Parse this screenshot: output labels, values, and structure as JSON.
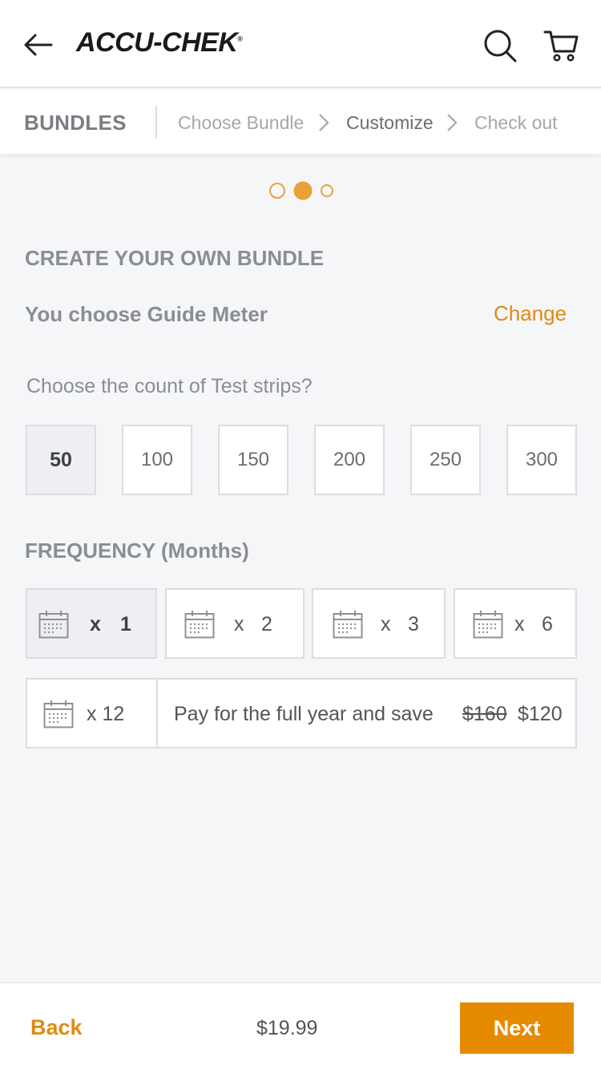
{
  "header": {
    "logo_text": "ACCU-CHEK",
    "logo_mark": "®",
    "icons": [
      "back-arrow-icon",
      "search-icon",
      "cart-icon"
    ]
  },
  "steps": {
    "title": "BUNDLES",
    "items": [
      {
        "label": "Choose Bundle",
        "state": "done"
      },
      {
        "label": "Customize",
        "state": "active"
      },
      {
        "label": "Check out",
        "state": "pending"
      }
    ]
  },
  "pager": {
    "total": 3,
    "active_index": 1
  },
  "bundle": {
    "title": "CREATE YOUR OWN BUNDLE",
    "meter_text": "You choose Guide Meter",
    "change_label": "Change"
  },
  "strips": {
    "question": "Choose the count of Test strips?",
    "options": [
      "50",
      "100",
      "150",
      "200",
      "250",
      "300"
    ],
    "selected": "50"
  },
  "frequency": {
    "title": "FREQUENCY (Months)",
    "options": [
      {
        "prefix": "x",
        "value": "1",
        "selected": true
      },
      {
        "prefix": "x",
        "value": "2",
        "selected": false
      },
      {
        "prefix": "x",
        "value": "3",
        "selected": false
      },
      {
        "prefix": "x",
        "value": "6",
        "selected": false
      }
    ],
    "yearly": {
      "label": "x 12",
      "text": "Pay for the full year and save",
      "old_price": "$160",
      "new_price": "$120"
    }
  },
  "footer": {
    "back_label": "Back",
    "price": "$19.99",
    "next_label": "Next"
  },
  "colors": {
    "accent": "#e68a00",
    "link": "#e08a12",
    "muted_text": "#8a8d92",
    "background": "#f5f6f8"
  }
}
